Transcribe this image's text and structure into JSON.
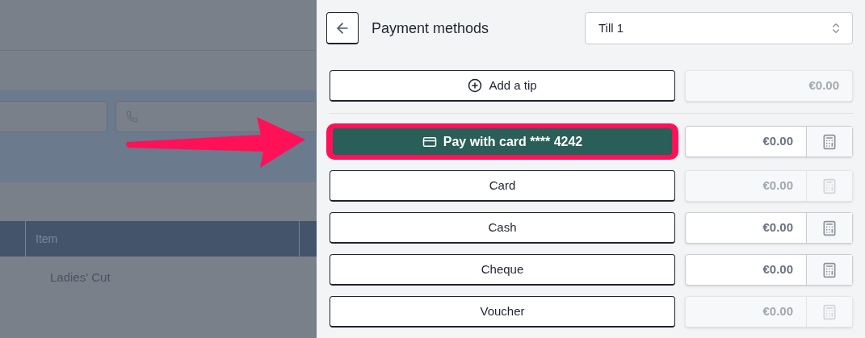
{
  "background": {
    "table": {
      "columns": [
        "Item"
      ],
      "rows": [
        [
          "Ladies' Cut"
        ]
      ]
    }
  },
  "panel": {
    "title": "Payment methods",
    "till_select": {
      "value": "Till 1"
    },
    "tip": {
      "label": "Add a tip",
      "amount": "€0.00",
      "disabled": true
    },
    "methods": [
      {
        "kind": "card_terminal",
        "label": "Pay with card **** 4242",
        "amount": "€0.00",
        "disabled": false,
        "highlighted": true
      },
      {
        "kind": "method",
        "label": "Card",
        "amount": "€0.00",
        "disabled": true,
        "highlighted": false
      },
      {
        "kind": "method",
        "label": "Cash",
        "amount": "€0.00",
        "disabled": false,
        "highlighted": false
      },
      {
        "kind": "method",
        "label": "Cheque",
        "amount": "€0.00",
        "disabled": false,
        "highlighted": false
      },
      {
        "kind": "method",
        "label": "Voucher",
        "amount": "€0.00",
        "disabled": true,
        "highlighted": false
      }
    ]
  }
}
